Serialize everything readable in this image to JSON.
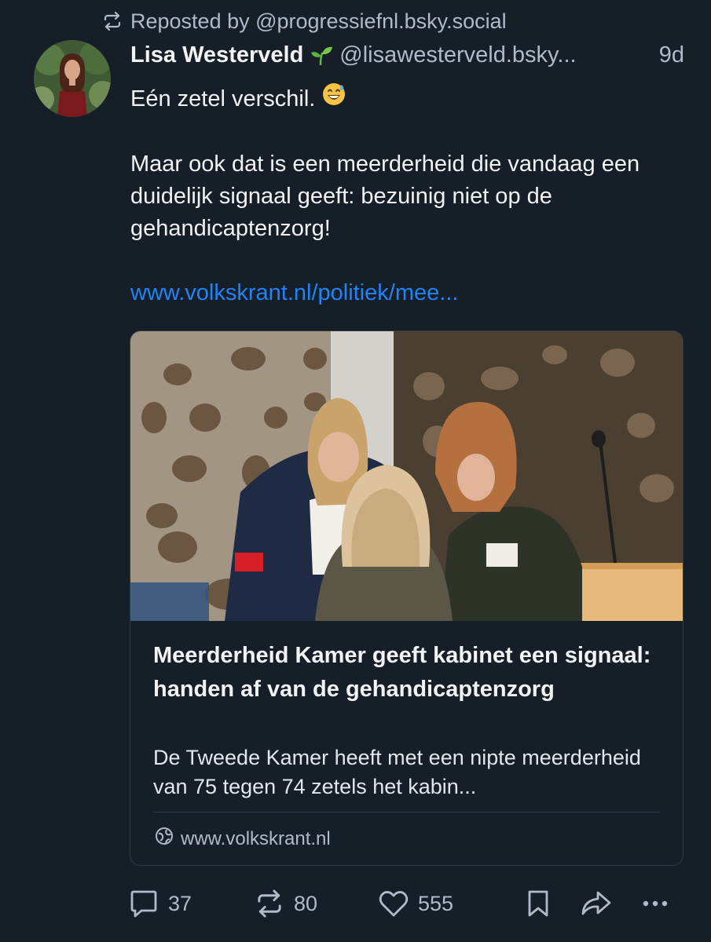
{
  "repost": {
    "icon": "repost-icon",
    "text": "Reposted by @progressiefnl.bsky.social"
  },
  "author": {
    "display_name": "Lisa Westerveld",
    "name_emoji": "sprout-icon",
    "handle": "@lisawesterveld.bsky...",
    "time": "9d",
    "avatar": "avatar"
  },
  "post": {
    "line1": "Eén zetel verschil.",
    "line1_emoji": "grinning-sweat-emoji",
    "paragraph2": "Maar ook dat is een meerderheid die vandaag een duidelijk signaal geeft: bezuinig niet op de gehandicaptenzorg!",
    "link_text": "www.volkskrant.nl/politiek/mee..."
  },
  "card": {
    "image": "news-photo-parliament",
    "title": "Meerderheid Kamer geeft kabinet een signaal: handen af van de gehandicaptenzorg",
    "description": "De Tweede Kamer heeft met een nipte meerderheid van 75 tegen 74 zetels het kabin...",
    "domain_icon": "globe-icon",
    "domain": "www.volkskrant.nl"
  },
  "actions": {
    "reply_count": "37",
    "repost_count": "80",
    "like_count": "555"
  },
  "colors": {
    "background": "#161e27",
    "text": "#f1f3f5",
    "muted": "#aebbc9",
    "link": "#1f84f5",
    "border": "#2f3b48"
  }
}
